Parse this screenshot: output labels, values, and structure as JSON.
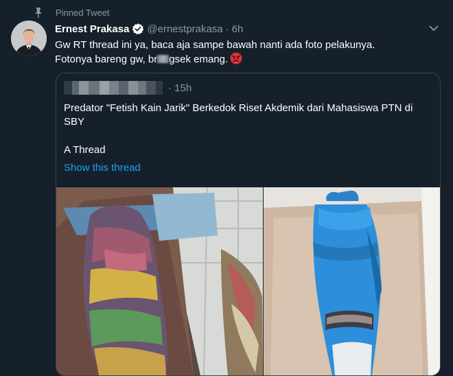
{
  "pinned": {
    "label": "Pinned Tweet",
    "icon": "pin-icon"
  },
  "tweet": {
    "display_name": "Ernest Prakasa",
    "handle": "@ernestprakasa",
    "separator": "·",
    "time": "6h",
    "text_line1": "Gw RT thread ini ya, baca aja sampe bawah nanti ada foto pelakunya.",
    "text_line2_before": "Fotonya bareng gw, br",
    "text_line2_after": "gsek emang.",
    "emoji": "angry-face-emoji"
  },
  "quote": {
    "separator": "·",
    "time": "15h",
    "text": "Predator \"Fetish Kain Jarik\" Berkedok Riset Akdemik dari Mahasiswa PTN di SBY",
    "thread_label": "A Thread",
    "show_thread": "Show this thread"
  },
  "colors": {
    "background": "#15202b",
    "secondary_text": "#8899a6",
    "link": "#1da1f2",
    "verified": "#ffffff",
    "border": "#38444d"
  }
}
